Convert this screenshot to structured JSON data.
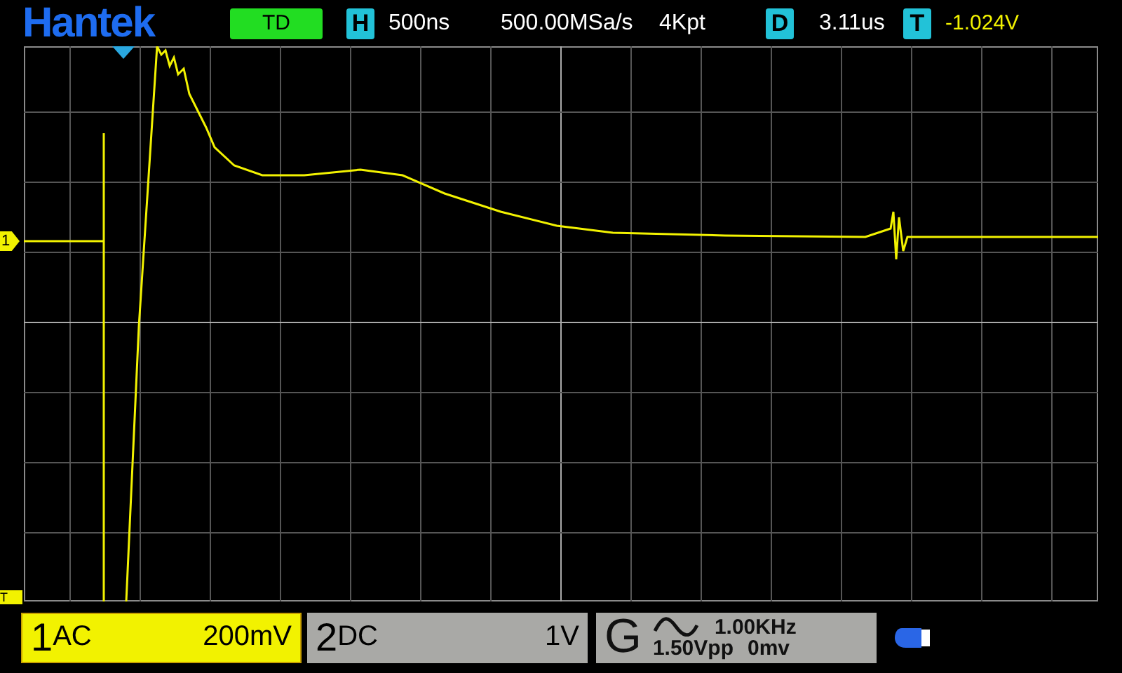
{
  "brand": "Hantek",
  "mode_badge": "TD",
  "horizontal": {
    "label": "H",
    "timebase": "500ns",
    "sample_rate": "500.00MSa/s",
    "memory": "4Kpt"
  },
  "delay": {
    "label": "D",
    "value": "3.11us"
  },
  "trigger": {
    "label": "T",
    "level": "-1.024V"
  },
  "markers": {
    "channel": "1",
    "trigger": "T"
  },
  "channels": [
    {
      "number": "1",
      "coupling": "AC",
      "scale": "200mV",
      "active": true
    },
    {
      "number": "2",
      "coupling": "DC",
      "scale": "1V",
      "active": false
    }
  ],
  "generator": {
    "label": "G",
    "frequency": "1.00KHz",
    "amplitude": "1.50Vpp",
    "offset": "0mv"
  }
}
